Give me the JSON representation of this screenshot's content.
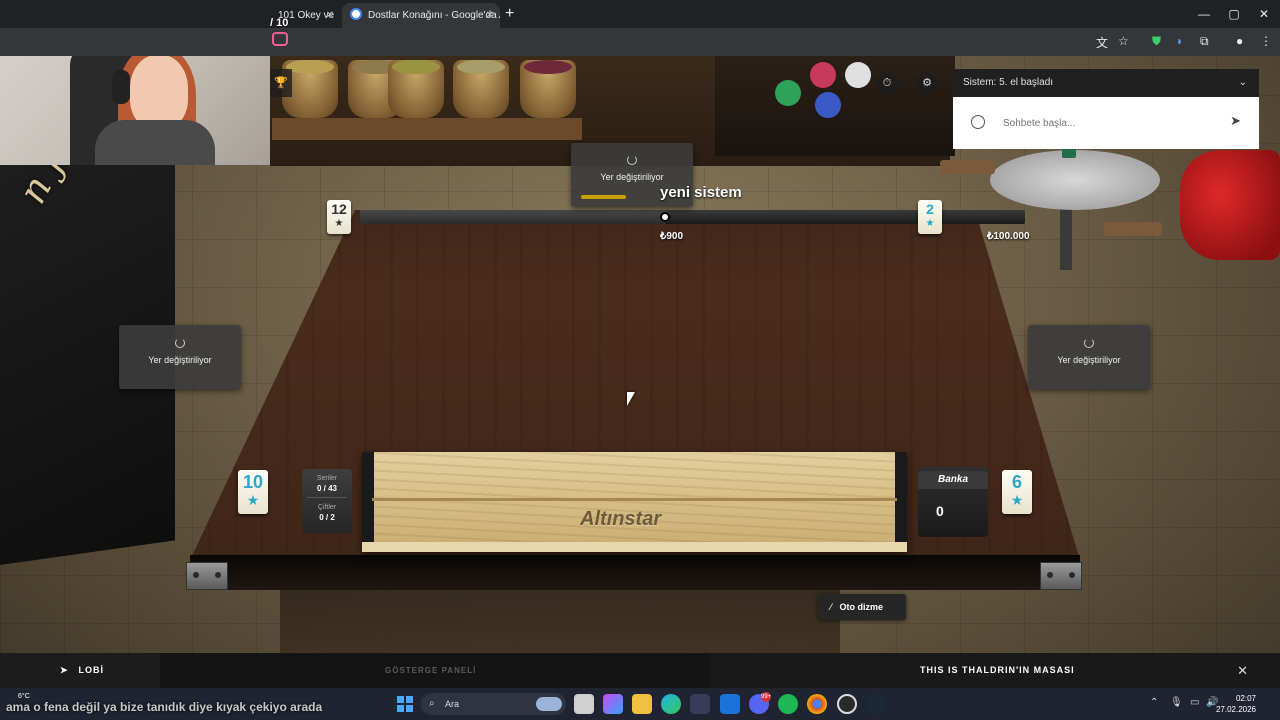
{
  "browser": {
    "tabs": [
      {
        "title": "101 Okey ve",
        "active": false
      },
      {
        "title": "Dostlar Konağını - Google'da A",
        "active": true
      }
    ],
    "new_tab": "+",
    "window_controls": [
      "—",
      "▢",
      "✕"
    ]
  },
  "stream": {
    "counter": "/ 10",
    "subtitle": "ama o fena değil ya bize tanıdık diye kıyak çekiyo arada"
  },
  "game": {
    "title": "yeni sistem",
    "pot": "₺900",
    "balance_right": "₺100.000",
    "seat_status": {
      "top": "Yer değiştiriliyor",
      "left": "Yer değiştiriliyor",
      "right": "Yer değiştiriliyor"
    },
    "tiles": {
      "top_left": {
        "number": "12",
        "symbol": "★",
        "color": "#333333"
      },
      "top_right": {
        "number": "2",
        "symbol": "★",
        "color": "#2aa7c9"
      },
      "bottom_left": {
        "number": "10",
        "symbol": "★",
        "color": "#2aa7c9"
      },
      "bottom_right": {
        "number": "6",
        "symbol": "★",
        "color": "#2aa7c9"
      }
    },
    "counters": {
      "series_label": "Seriler",
      "series_value": "0 / 43",
      "pairs_label": "Çiftler",
      "pairs_value": "0 / 2"
    },
    "rack_logo": "Altınstar",
    "bank": {
      "label": "Banka",
      "value": "0"
    },
    "auto_arrange": "Oto dizme"
  },
  "chat": {
    "header": "Sistem: 5. el başladı",
    "placeholder": "Sohbete başla..."
  },
  "bottom_bar": {
    "lobby": "LOBİ",
    "indicator_panel": "GÖSTERGE PANELİ",
    "table_name": "THIS IS THALDRIN'IN MASASI"
  },
  "taskbar": {
    "weather": "6°C",
    "search": "Ara",
    "badge": "99+",
    "time": "02:07",
    "date": "27.02.2026"
  },
  "colors": {
    "accent_gold": "#c9a000",
    "tile_blue": "#2aa7c9",
    "chat_bg": "#202020"
  }
}
